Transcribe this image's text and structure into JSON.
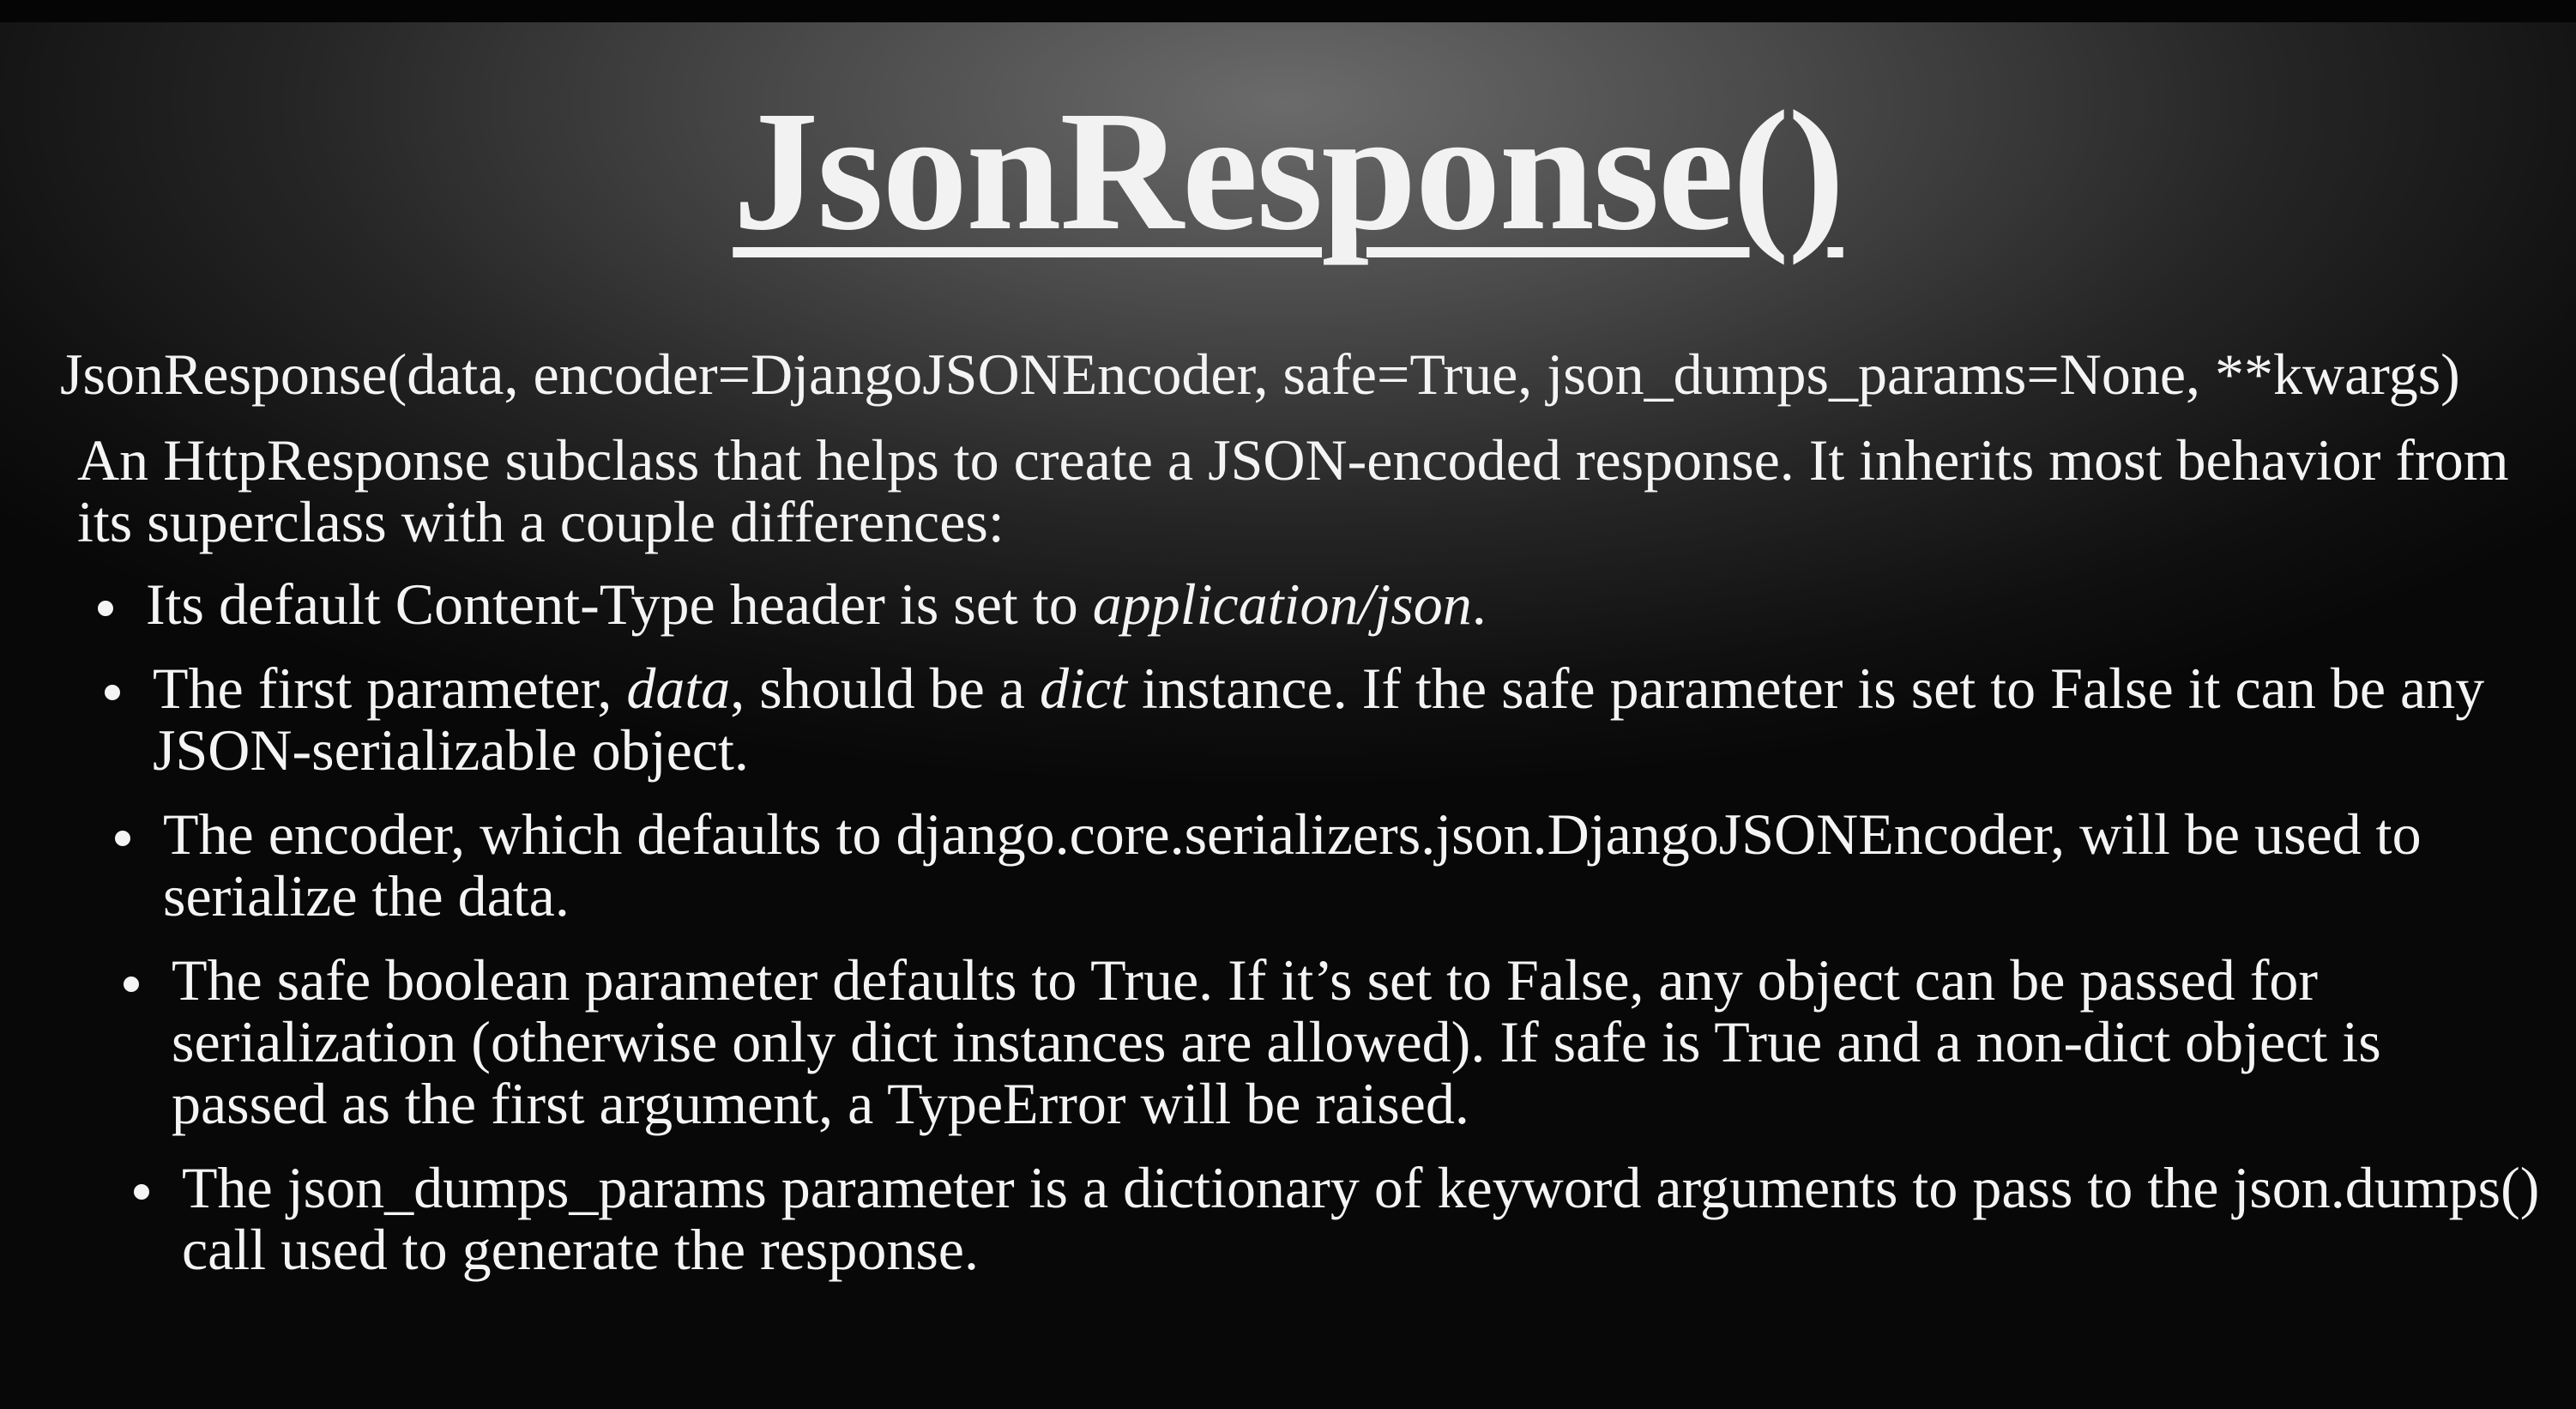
{
  "slide": {
    "title": "JsonResponse()",
    "signature": "JsonResponse(data, encoder=DjangoJSONEncoder, safe=True, json_dumps_params=None, **kwargs)",
    "intro": "An HttpResponse subclass that helps to create a JSON-encoded response. It inherits most behavior from its superclass with a couple differences:",
    "bullets": [
      {
        "t1": "Its default Content-Type header is set to ",
        "i1": "application/json",
        "t2": "."
      },
      {
        "t1": "The first parameter, ",
        "i1": "data",
        "t2": ", should be a ",
        "i2": "dict",
        "t3": " instance. If the safe parameter is set to False it can be any JSON-serializable object."
      },
      {
        "t1": "The encoder, which defaults to django.core.serializers.json.DjangoJSONEncoder, will be used to serialize the data."
      },
      {
        "t1": "The safe boolean parameter defaults to True. If it’s set to False, any object can be passed for serialization (otherwise only dict instances are allowed). If safe is True and a non-dict object is passed as the first argument, a TypeError will be raised."
      },
      {
        "t1": "The json_dumps_params parameter is a dictionary of keyword arguments to pass to the json.dumps() call used to generate the response."
      }
    ]
  }
}
